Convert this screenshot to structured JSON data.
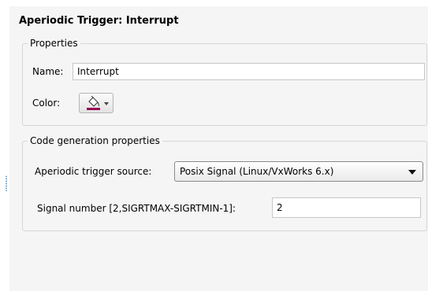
{
  "header": {
    "title": "Aperiodic Trigger: Interrupt"
  },
  "properties": {
    "legend": "Properties",
    "name_label": "Name:",
    "name_value": "Interrupt",
    "color_label": "Color:",
    "color_swatch": "#990055"
  },
  "codegen": {
    "legend": "Code generation properties",
    "source_label": "Aperiodic trigger source:",
    "source_value": "Posix Signal (Linux/VxWorks 6.x)",
    "signal_label": "Signal number [2,SIGRTMAX-SIGRTMIN-1]:",
    "signal_value": "2"
  },
  "icons": [
    "paint-bucket-icon",
    "dropdown-caret-icon",
    "dropdown-arrow-icon"
  ]
}
